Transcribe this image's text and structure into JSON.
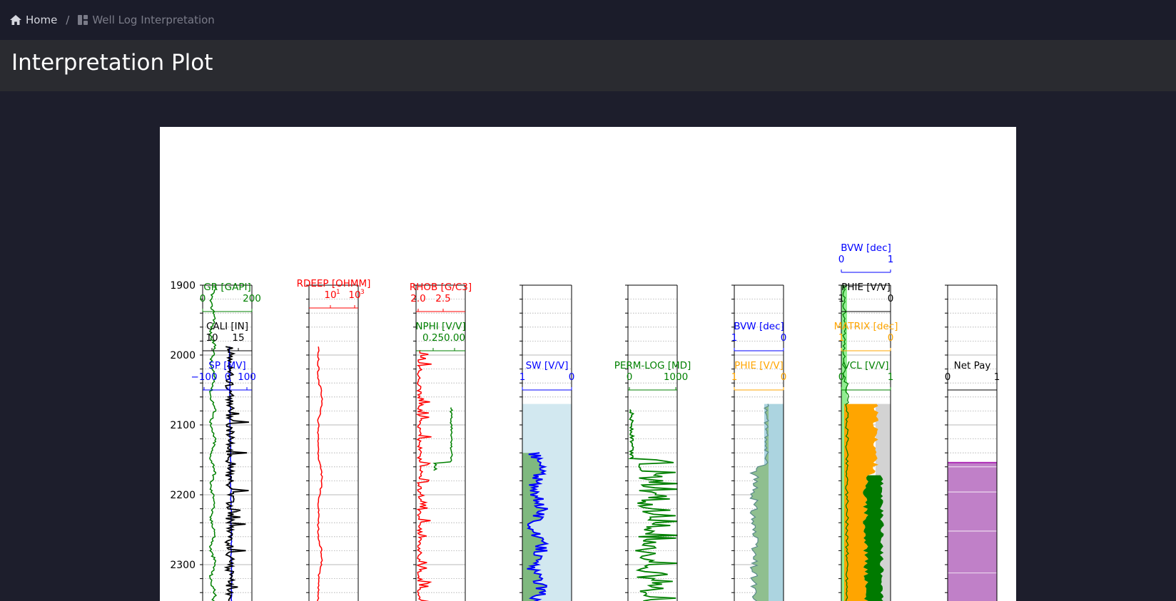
{
  "breadcrumb": {
    "home": "Home",
    "separator": "/",
    "current": "Well Log Interpretation"
  },
  "page": {
    "title": "Interpretation Plot"
  },
  "colors": {
    "background": "#1d1e2c",
    "header": "#2a2b30",
    "gr": "#008000",
    "sp": "#0000ff",
    "rdeep": "#ff0000",
    "matrix": "#ffa500",
    "netpay": "#c080c8"
  },
  "plot": {
    "depth_ticks": [
      "1900",
      "2000",
      "2100",
      "2200",
      "2300"
    ],
    "tracks": [
      {
        "name": "GR-SP-CALI",
        "curves": [
          {
            "label": "GR [GAPI]",
            "color": "#008000",
            "ticks": [
              "0",
              "200"
            ]
          },
          {
            "label": "CALI [IN]",
            "color": "#000000",
            "ticks": [
              "10",
              "15"
            ]
          },
          {
            "label": "SP [MV]",
            "color": "#0000ff",
            "ticks": [
              "−100",
              "0",
              "100"
            ]
          }
        ]
      },
      {
        "name": "RDEEP",
        "curves": [
          {
            "label": "RDEEP [OHMM]",
            "color": "#ff0000",
            "ticks": [
              "10",
              "10"
            ],
            "tick_exponents": [
              "1",
              "3"
            ]
          }
        ]
      },
      {
        "name": "RHOB-NPHI",
        "curves": [
          {
            "label": "RHOB [G/C3]",
            "color": "#ff0000",
            "ticks": [
              "2.0",
              "2.5"
            ]
          },
          {
            "label": "NPHI [V/V]",
            "color": "#008000",
            "ticks": [
              "0.25",
              "0.00"
            ]
          }
        ]
      },
      {
        "name": "SW",
        "curves": [
          {
            "label": "SW [V/V]",
            "color": "#0000ff",
            "ticks": [
              "1",
              "0"
            ]
          }
        ]
      },
      {
        "name": "PERM",
        "curves": [
          {
            "label": "PERM-LOG [MD]",
            "color": "#008000",
            "ticks": [
              "0",
              "1000"
            ]
          }
        ]
      },
      {
        "name": "PHIE-BVW",
        "curves": [
          {
            "label": "BVW [dec]",
            "color": "#0000ff",
            "ticks": [
              "1",
              "0"
            ]
          },
          {
            "label": "PHIE [V/V]",
            "color": "#ffa500",
            "ticks": [
              "1",
              "0"
            ]
          }
        ]
      },
      {
        "name": "LITHO",
        "curves": [
          {
            "label": "BVW [dec]",
            "color": "#0000ff",
            "ticks": [
              "0",
              "1"
            ]
          },
          {
            "label": "PHIE [V/V]",
            "color": "#000000",
            "ticks": [
              "1",
              "0"
            ]
          },
          {
            "label": "MATRIX [dec]",
            "color": "#ffa500",
            "ticks": [
              "1",
              "0"
            ]
          },
          {
            "label": "VCL [V/V]",
            "color": "#008000",
            "ticks": [
              "0",
              "1"
            ]
          }
        ]
      },
      {
        "name": "NETPAY",
        "curves": [
          {
            "label": "Net Pay",
            "color": "#000000",
            "ticks": [
              "0",
              "1"
            ]
          }
        ]
      }
    ]
  }
}
